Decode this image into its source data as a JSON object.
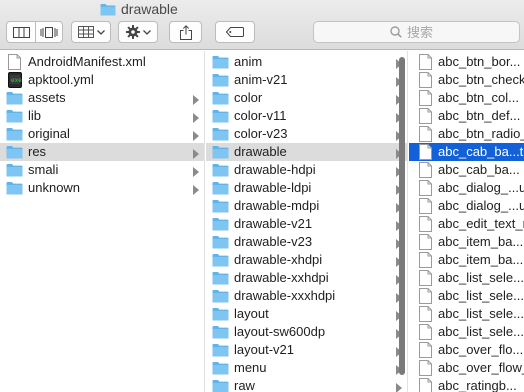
{
  "window": {
    "title": "drawable"
  },
  "toolbar": {
    "view_buttons": [
      "icon-view",
      "columns-view"
    ],
    "search_placeholder": "搜索"
  },
  "columns": [
    {
      "items": [
        {
          "label": "AndroidManifest.xml",
          "kind": "document",
          "folder": false
        },
        {
          "label": "apktool.yml",
          "kind": "executable",
          "folder": false
        },
        {
          "label": "assets",
          "kind": "folder",
          "folder": true
        },
        {
          "label": "lib",
          "kind": "folder",
          "folder": true
        },
        {
          "label": "original",
          "kind": "folder",
          "folder": true
        },
        {
          "label": "res",
          "kind": "folder",
          "folder": true,
          "selected": "grey"
        },
        {
          "label": "smali",
          "kind": "folder",
          "folder": true
        },
        {
          "label": "unknown",
          "kind": "folder",
          "folder": true
        }
      ]
    },
    {
      "items": [
        {
          "label": "anim",
          "kind": "folder",
          "folder": true
        },
        {
          "label": "anim-v21",
          "kind": "folder",
          "folder": true
        },
        {
          "label": "color",
          "kind": "folder",
          "folder": true
        },
        {
          "label": "color-v11",
          "kind": "folder",
          "folder": true
        },
        {
          "label": "color-v23",
          "kind": "folder",
          "folder": true
        },
        {
          "label": "drawable",
          "kind": "folder",
          "folder": true,
          "selected": "grey"
        },
        {
          "label": "drawable-hdpi",
          "kind": "folder",
          "folder": true
        },
        {
          "label": "drawable-ldpi",
          "kind": "folder",
          "folder": true
        },
        {
          "label": "drawable-mdpi",
          "kind": "folder",
          "folder": true
        },
        {
          "label": "drawable-v21",
          "kind": "folder",
          "folder": true
        },
        {
          "label": "drawable-v23",
          "kind": "folder",
          "folder": true
        },
        {
          "label": "drawable-xhdpi",
          "kind": "folder",
          "folder": true
        },
        {
          "label": "drawable-xxhdpi",
          "kind": "folder",
          "folder": true
        },
        {
          "label": "drawable-xxxhdpi",
          "kind": "folder",
          "folder": true
        },
        {
          "label": "layout",
          "kind": "folder",
          "folder": true
        },
        {
          "label": "layout-sw600dp",
          "kind": "folder",
          "folder": true
        },
        {
          "label": "layout-v21",
          "kind": "folder",
          "folder": true
        },
        {
          "label": "menu",
          "kind": "folder",
          "folder": true
        },
        {
          "label": "raw",
          "kind": "folder",
          "folder": true
        }
      ]
    },
    {
      "items": [
        {
          "label": "abc_btn_bor...",
          "kind": "document",
          "folder": false
        },
        {
          "label": "abc_btn_check",
          "kind": "document",
          "folder": false
        },
        {
          "label": "abc_btn_col...",
          "kind": "document",
          "folder": false
        },
        {
          "label": "abc_btn_def...",
          "kind": "document",
          "folder": false
        },
        {
          "label": "abc_btn_radio_",
          "kind": "document",
          "folder": false
        },
        {
          "label": "abc_cab_ba...t",
          "kind": "document",
          "folder": false,
          "selected": "blue"
        },
        {
          "label": "abc_cab_ba...",
          "kind": "document",
          "folder": false
        },
        {
          "label": "abc_dialog_...u",
          "kind": "document",
          "folder": false
        },
        {
          "label": "abc_dialog_...u",
          "kind": "document",
          "folder": false
        },
        {
          "label": "abc_edit_text_n",
          "kind": "document",
          "folder": false
        },
        {
          "label": "abc_item_ba...",
          "kind": "document",
          "folder": false
        },
        {
          "label": "abc_item_ba...",
          "kind": "document",
          "folder": false
        },
        {
          "label": "abc_list_sele...",
          "kind": "document",
          "folder": false
        },
        {
          "label": "abc_list_sele...",
          "kind": "document",
          "folder": false
        },
        {
          "label": "abc_list_sele...",
          "kind": "document",
          "folder": false
        },
        {
          "label": "abc_list_sele...",
          "kind": "document",
          "folder": false
        },
        {
          "label": "abc_over_flo...",
          "kind": "document",
          "folder": false
        },
        {
          "label": "abc_over_flow_",
          "kind": "document",
          "folder": false
        },
        {
          "label": "abc_ratingb...",
          "kind": "document",
          "folder": false
        }
      ]
    }
  ],
  "colors": {
    "folder": "#5fb4ea",
    "selection_blue": "#1361d9",
    "selection_grey": "#dcdcdc"
  }
}
